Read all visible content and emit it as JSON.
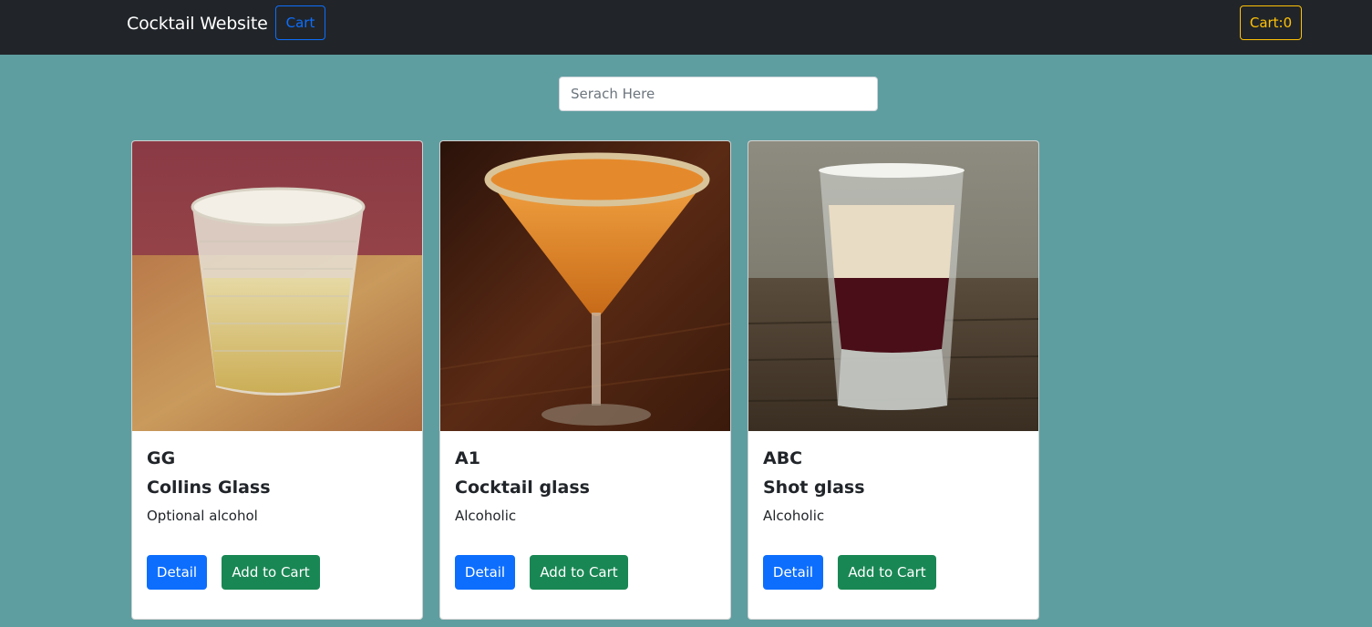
{
  "navbar": {
    "brand": "Cocktail Website",
    "cart_link": "Cart",
    "cart_count": "Cart:0"
  },
  "search": {
    "placeholder": "Serach Here",
    "value": ""
  },
  "cards": [
    {
      "name": "GG",
      "glass": "Collins Glass",
      "alcoholic": "Optional alcohol",
      "detail_label": "Detail",
      "add_label": "Add to Cart"
    },
    {
      "name": "A1",
      "glass": "Cocktail glass",
      "alcoholic": "Alcoholic",
      "detail_label": "Detail",
      "add_label": "Add to Cart"
    },
    {
      "name": "ABC",
      "glass": "Shot glass",
      "alcoholic": "Alcoholic",
      "detail_label": "Detail",
      "add_label": "Add to Cart"
    }
  ],
  "colors": {
    "navbar_bg": "#212529",
    "page_bg": "#5f9ea0",
    "primary": "#0d6efd",
    "success": "#198754",
    "warning": "#ffc107"
  }
}
